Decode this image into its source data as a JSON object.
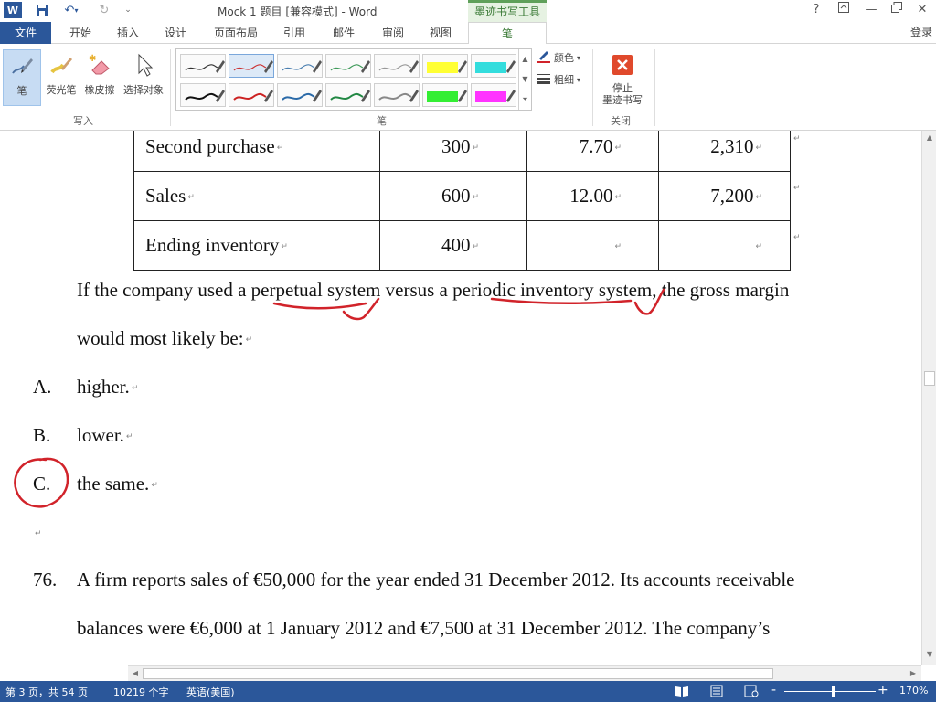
{
  "titlebar": {
    "title": "Mock 1 题目 [兼容模式] - Word",
    "contextual_group": "墨迹书写工具",
    "help": "?",
    "minimize": "—",
    "close": "✕"
  },
  "tabs": {
    "file": "文件",
    "items": [
      "开始",
      "插入",
      "设计",
      "页面布局",
      "引用",
      "邮件",
      "审阅",
      "视图"
    ],
    "active": "笔",
    "signin": "登录"
  },
  "ribbon": {
    "write_group": {
      "label": "写入",
      "buttons": [
        "笔",
        "荧光笔",
        "橡皮擦",
        "选择对象"
      ]
    },
    "pens_group": {
      "label": "笔",
      "color": "颜色",
      "thickness": "粗细"
    },
    "close_group": {
      "label": "关闭",
      "stop_inking": "停止\n墨迹书写",
      "stop_line1": "停止",
      "stop_line2": "墨迹书写"
    },
    "pen_colors": [
      "#333333",
      "#cc3333",
      "#4a7fb0",
      "#3f9a5a",
      "#999999",
      "#ffff33",
      "#33dddd",
      "#111111",
      "#cc2222",
      "#2a6aa8",
      "#228844",
      "#888888",
      "#33ee33",
      "#ff33ff"
    ]
  },
  "document": {
    "table": [
      [
        "Second purchase",
        "300",
        "7.70",
        "2,310"
      ],
      [
        "Sales",
        "600",
        "12.00",
        "7,200"
      ],
      [
        "Ending inventory",
        "400",
        "",
        ""
      ]
    ],
    "q_line1": "If the company used a perpetual system versus a periodic inventory system, the gross margin",
    "q_line2": "would most likely be:",
    "options": [
      {
        "letter": "A.",
        "text": "higher."
      },
      {
        "letter": "B.",
        "text": "lower."
      },
      {
        "letter": "C.",
        "text": "the same."
      }
    ],
    "q76_number": "76.",
    "q76_line1": "A firm reports sales of €50,000 for the year ended 31 December 2012. Its accounts receivable",
    "q76_line2": "balances were €6,000 at 1 January 2012 and €7,500 at 31 December 2012. The company’s"
  },
  "statusbar": {
    "page": "第 3 页，共 54 页",
    "words": "10219 个字",
    "language": "英语(美国)",
    "zoom": "170%",
    "zoom_out": "-",
    "zoom_in": "+"
  },
  "colors": {
    "accent": "#2b579a",
    "ink": "#d1232a",
    "contextual": "#5fa05a"
  }
}
